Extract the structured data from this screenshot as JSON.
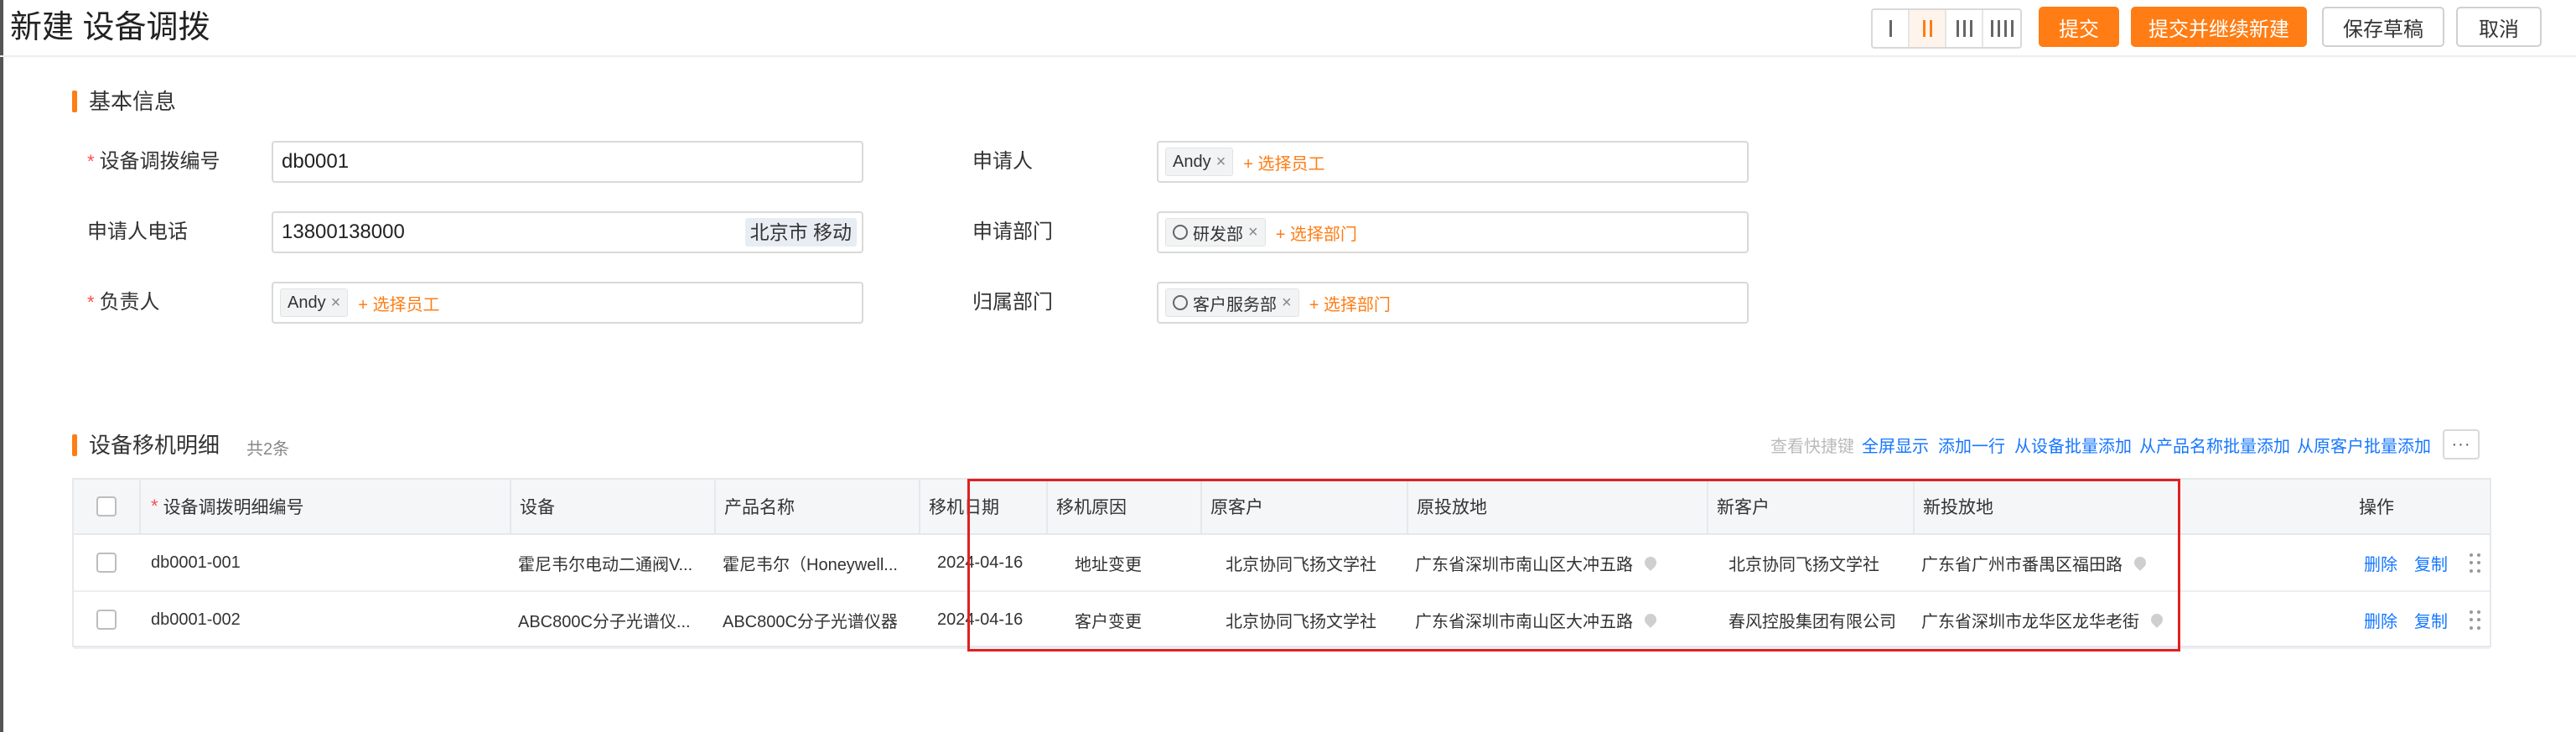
{
  "header": {
    "title": "新建 设备调拨",
    "buttons": {
      "submit": "提交",
      "submit_continue": "提交并继续新建",
      "save_draft": "保存草稿",
      "cancel": "取消"
    },
    "layout_columns": [
      1,
      2,
      3,
      4
    ],
    "layout_active": 2
  },
  "basic_info": {
    "section_title": "基本信息",
    "fields": {
      "code_label": "设备调拨编号",
      "code_value": "db0001",
      "phone_label": "申请人电话",
      "phone_value": "13800138000",
      "phone_suffix": "北京市 移动",
      "owner_label": "负责人",
      "owner_tag": "Andy",
      "owner_add": "+ 选择员工",
      "applicant_label": "申请人",
      "applicant_tag": "Andy",
      "applicant_add": "+ 选择员工",
      "apply_dept_label": "申请部门",
      "apply_dept_tag": "研发部",
      "apply_dept_add": "+ 选择部门",
      "belong_dept_label": "归属部门",
      "belong_dept_tag": "客户服务部",
      "belong_dept_add": "+ 选择部门"
    }
  },
  "detail": {
    "section_title": "设备移机明细",
    "count": "共2条",
    "toolbar": {
      "shortcut": "查看快捷键",
      "fullscreen": "全屏显示",
      "add_row": "添加一行",
      "add_by_device": "从设备批量添加",
      "add_by_product": "从产品名称批量添加",
      "add_by_customer": "从原客户批量添加",
      "more": "···"
    },
    "columns": {
      "code": "设备调拨明细编号",
      "device": "设备",
      "product": "产品名称",
      "date": "移机日期",
      "reason": "移机原因",
      "old_customer": "原客户",
      "old_location": "原投放地",
      "new_customer": "新客户",
      "new_location": "新投放地",
      "ops": "操作"
    },
    "rows": [
      {
        "code": "db0001-001",
        "device": "霍尼韦尔电动二通阀V...",
        "product": "霍尼韦尔（Honeywell...",
        "date": "2024-04-16",
        "reason": "地址变更",
        "old_customer": "北京协同飞扬文学社",
        "old_location": "广东省深圳市南山区大冲五路",
        "new_customer": "北京协同飞扬文学社",
        "new_location": "广东省广州市番禺区福田路",
        "op_delete": "删除",
        "op_copy": "复制"
      },
      {
        "code": "db0001-002",
        "device": "ABC800C分子光谱仪...",
        "product": "ABC800C分子光谱仪器",
        "date": "2024-04-16",
        "reason": "客户变更",
        "old_customer": "北京协同飞扬文学社",
        "old_location": "广东省深圳市南山区大冲五路",
        "new_customer": "春风控股集团有限公司",
        "new_location": "广东省深圳市龙华区龙华老街",
        "op_delete": "删除",
        "op_copy": "复制"
      }
    ]
  },
  "colors": {
    "accent": "#ff7d14",
    "link": "#1677ff",
    "required": "#ff4d4f",
    "highlight_border": "#e02020"
  }
}
